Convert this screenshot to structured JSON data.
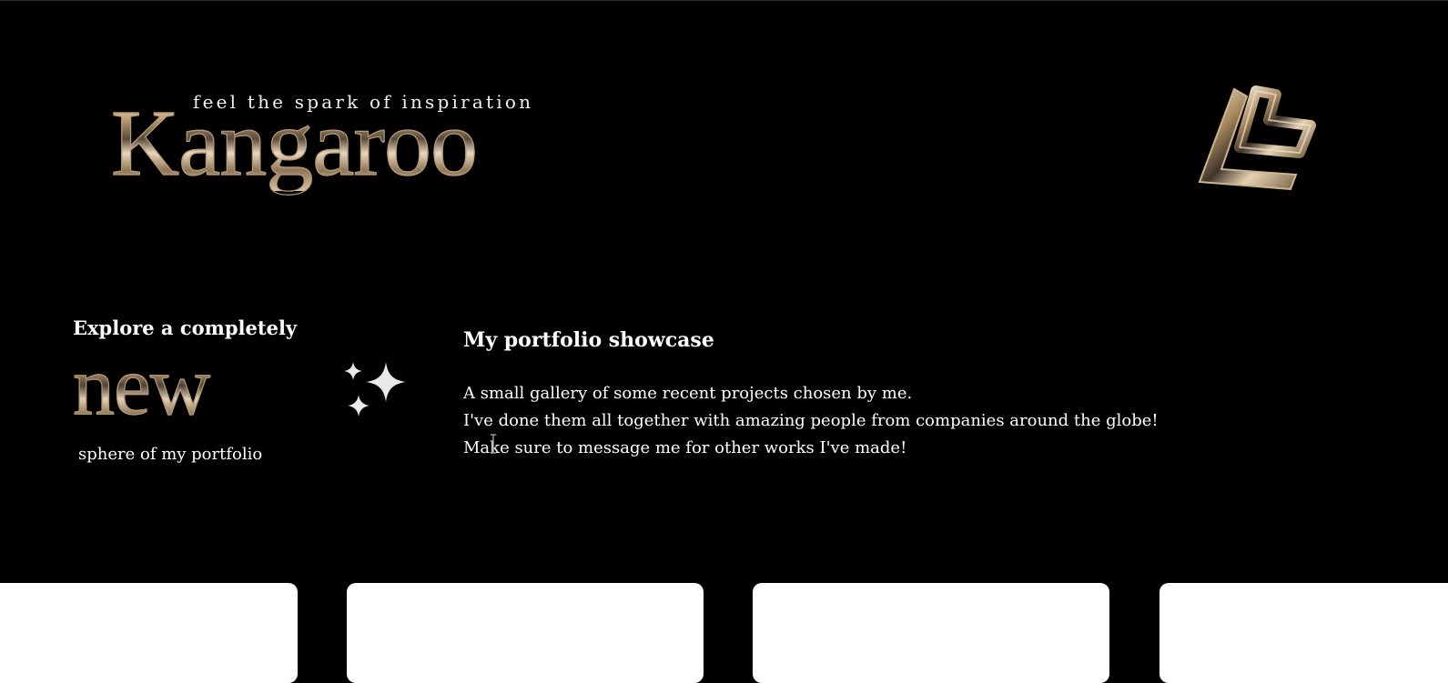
{
  "header": {
    "tagline": "feel the spark of inspiration",
    "wordmark": "Kangaroo",
    "logo_icon": "chrome-monogram-logo-icon"
  },
  "feature": {
    "title": "Explore a completely",
    "highlight_word": "new",
    "subtitle": "sphere of my portfolio",
    "icon": "sparkles-icon"
  },
  "showcase": {
    "title": "My portfolio showcase",
    "lines": [
      "A small gallery of some recent projects chosen by me.",
      "I've done them all together with amazing people from companies around the globe!",
      "Make sure to message me for other works I've made!"
    ]
  },
  "gallery": {
    "card_count": 4
  },
  "colors": {
    "background": "#000000",
    "text": "#ffffff",
    "chrome_light": "#f6ecdc",
    "chrome_dark": "#4f4236",
    "card": "#ffffff"
  }
}
